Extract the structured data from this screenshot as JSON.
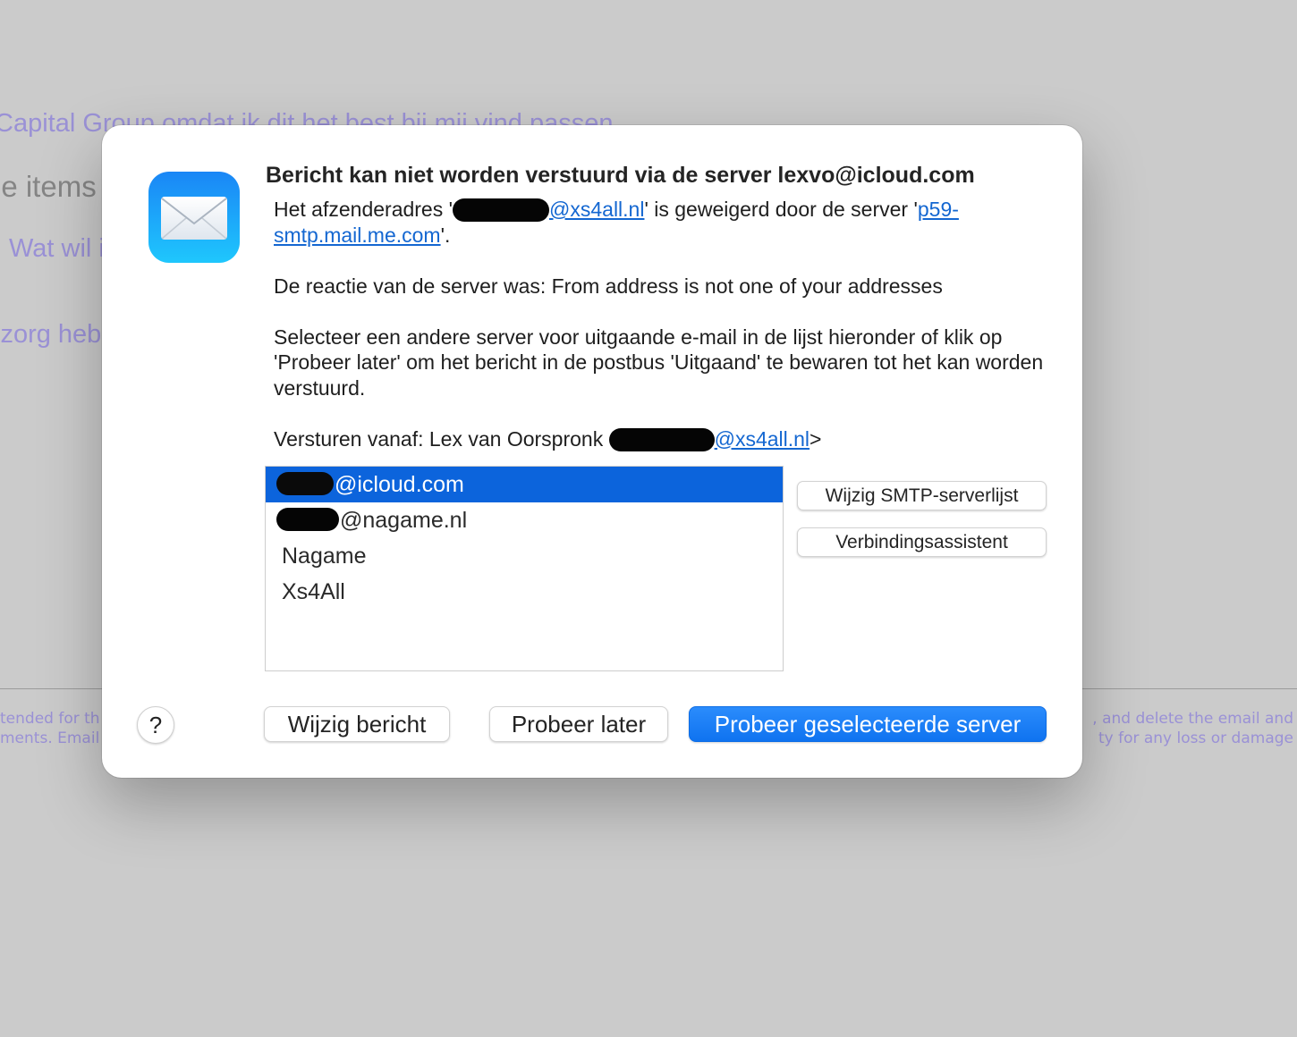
{
  "background": {
    "line1": "Capital Group omdat ik dit het best bij mij vind passen",
    "line2": "le items",
    "line3": "Wat wil i",
    "line4": "lzorg heb",
    "footer_left_1": "tended for th",
    "footer_left_2": "ments. Email",
    "footer_right_1": ", and delete the email and",
    "footer_right_2": "ty for any loss or damage"
  },
  "dialog": {
    "icon": "mail-app-icon",
    "title": "Bericht kan niet worden verstuurd via de server lexvo@icloud.com",
    "p1": {
      "prefix": "Het afzenderadres '",
      "email_visible": "@xs4all.nl",
      "middle": "' is geweigerd door de server '",
      "server_part1": "p59-",
      "server_part2": "smtp.mail.me.com",
      "suffix": "'."
    },
    "p2": "De reactie van de server was: From address is not one of your addresses",
    "p3": "Selecteer een andere server voor uitgaande e-mail in de lijst hieronder of klik op 'Probeer later' om het bericht in de postbus 'Uitgaand' te bewaren tot het kan worden verstuurd.",
    "p4": {
      "prefix": "Versturen vanaf: Lex van Oorspronk ",
      "email_visible": "@xs4all.nl",
      "suffix": ">"
    },
    "servers": [
      {
        "label": "@icloud.com",
        "selected": true
      },
      {
        "label": "@nagame.nl",
        "selected": false
      },
      {
        "label": "Nagame",
        "selected": false
      },
      {
        "label": "Xs4All",
        "selected": false
      }
    ],
    "buttons": {
      "edit_smtp": "Wijzig SMTP-serverlijst",
      "connection_assistant": "Verbindingsassistent",
      "help": "?",
      "edit_message": "Wijzig bericht",
      "try_later": "Probeer later",
      "try_selected": "Probeer geselecteerde server"
    },
    "colors": {
      "accent": "#0f73f0",
      "selection": "#0c64dc",
      "link": "#1467d1"
    }
  }
}
